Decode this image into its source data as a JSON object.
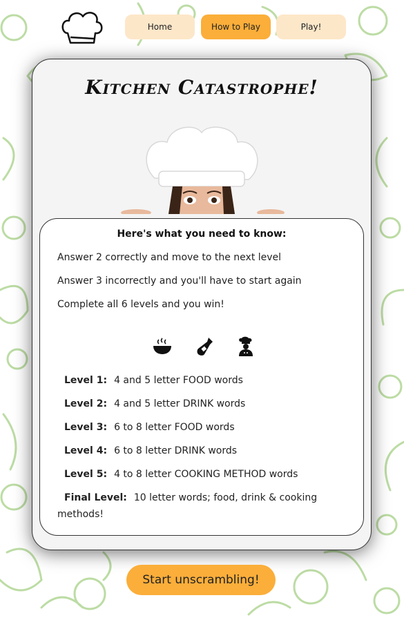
{
  "nav": {
    "logo_icon": "chef-hat-icon",
    "items": [
      {
        "label": "Home",
        "active": false
      },
      {
        "label": "How to Play",
        "active": true
      },
      {
        "label": "Play!",
        "active": false
      }
    ]
  },
  "card": {
    "title": "Kitchen Catastrophe!",
    "info": {
      "heading": "Here's what you need to know:",
      "rules": [
        "Answer 2 correctly and move to the next level",
        "Answer 3 incorrectly and you'll have to start again",
        "Complete all 6 levels and you win!"
      ],
      "icons": [
        "food-bowl-icon",
        "bottle-icon",
        "chef-icon"
      ],
      "levels": [
        {
          "name": "Level 1:",
          "desc": "4 and 5 letter FOOD words"
        },
        {
          "name": "Level 2:",
          "desc": "4 and 5 letter DRINK words"
        },
        {
          "name": "Level 3:",
          "desc": "6 to 8 letter FOOD words"
        },
        {
          "name": "Level 4:",
          "desc": "6 to 8 letter DRINK words"
        },
        {
          "name": "Level 5:",
          "desc": "4 to 8 letter COOKING METHOD words"
        },
        {
          "name": "Final Level:",
          "desc": "10 letter words; food, drink & cooking methods!"
        }
      ]
    }
  },
  "start_button": {
    "label": "Start unscrambling!"
  },
  "colors": {
    "accent": "#fbae3a",
    "nav_inactive": "#fde7c9",
    "pattern": "#b9dca0"
  }
}
